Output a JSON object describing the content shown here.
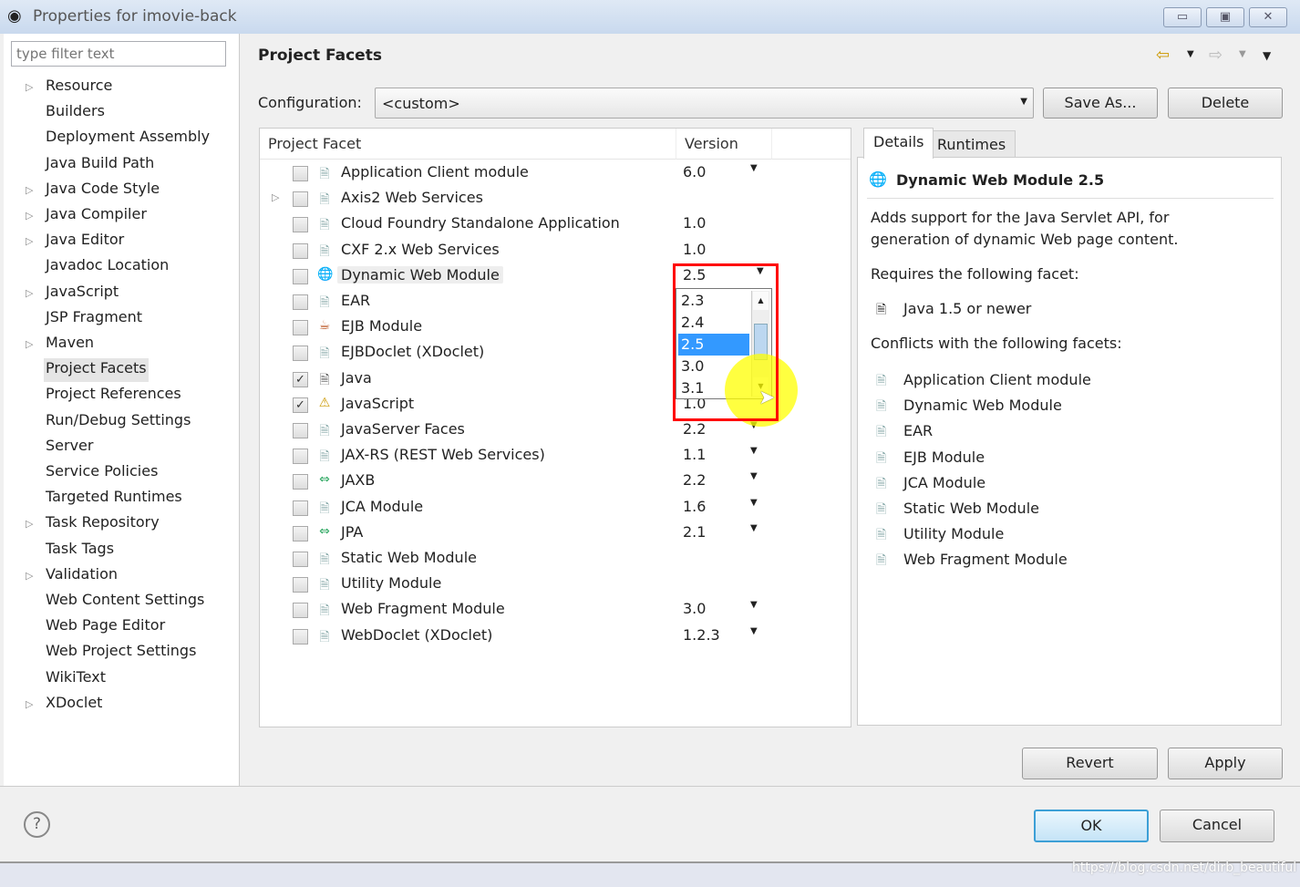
{
  "window": {
    "title": "Properties for imovie-back",
    "buttons": [
      "minimize",
      "maximize",
      "close"
    ]
  },
  "sidebar": {
    "filter_placeholder": "type filter text",
    "items": [
      {
        "label": "Resource",
        "expandable": true
      },
      {
        "label": "Builders"
      },
      {
        "label": "Deployment Assembly"
      },
      {
        "label": "Java Build Path"
      },
      {
        "label": "Java Code Style",
        "expandable": true
      },
      {
        "label": "Java Compiler",
        "expandable": true
      },
      {
        "label": "Java Editor",
        "expandable": true
      },
      {
        "label": "Javadoc Location"
      },
      {
        "label": "JavaScript",
        "expandable": true
      },
      {
        "label": "JSP Fragment"
      },
      {
        "label": "Maven",
        "expandable": true
      },
      {
        "label": "Project Facets",
        "selected": true
      },
      {
        "label": "Project References"
      },
      {
        "label": "Run/Debug Settings"
      },
      {
        "label": "Server"
      },
      {
        "label": "Service Policies"
      },
      {
        "label": "Targeted Runtimes"
      },
      {
        "label": "Task Repository",
        "expandable": true
      },
      {
        "label": "Task Tags"
      },
      {
        "label": "Validation",
        "expandable": true
      },
      {
        "label": "Web Content Settings"
      },
      {
        "label": "Web Page Editor"
      },
      {
        "label": "Web Project Settings"
      },
      {
        "label": "WikiText"
      },
      {
        "label": "XDoclet",
        "expandable": true
      }
    ]
  },
  "page": {
    "title": "Project Facets",
    "config_label": "Configuration:",
    "config_value": "<custom>",
    "save_as": "Save As...",
    "delete": "Delete",
    "col_facet": "Project Facet",
    "col_version": "Version"
  },
  "facets": [
    {
      "name": "Application Client module",
      "version": "6.0",
      "dropdown": true,
      "icon": "file"
    },
    {
      "name": "Axis2 Web Services",
      "version": "",
      "icon": "file",
      "expandable": true
    },
    {
      "name": "Cloud Foundry Standalone Application",
      "version": "1.0",
      "icon": "file"
    },
    {
      "name": "CXF 2.x Web Services",
      "version": "1.0",
      "icon": "file"
    },
    {
      "name": "Dynamic Web Module",
      "version": "2.5",
      "dropdown": true,
      "icon": "globe",
      "highlighted": true
    },
    {
      "name": "EAR",
      "version": "",
      "icon": "file"
    },
    {
      "name": "EJB Module",
      "version": "",
      "icon": "bean"
    },
    {
      "name": "EJBDoclet (XDoclet)",
      "version": "",
      "icon": "file"
    },
    {
      "name": "Java",
      "version": "",
      "icon": "java",
      "checked": true
    },
    {
      "name": "JavaScript",
      "version": "1.0",
      "icon": "js",
      "checked": true
    },
    {
      "name": "JavaServer Faces",
      "version": "2.2",
      "dropdown": true,
      "icon": "file"
    },
    {
      "name": "JAX-RS (REST Web Services)",
      "version": "1.1",
      "dropdown": true,
      "icon": "file"
    },
    {
      "name": "JAXB",
      "version": "2.2",
      "dropdown": true,
      "icon": "arrows"
    },
    {
      "name": "JCA Module",
      "version": "1.6",
      "dropdown": true,
      "icon": "file"
    },
    {
      "name": "JPA",
      "version": "2.1",
      "dropdown": true,
      "icon": "arrows"
    },
    {
      "name": "Static Web Module",
      "version": "",
      "icon": "file"
    },
    {
      "name": "Utility Module",
      "version": "",
      "icon": "file"
    },
    {
      "name": "Web Fragment Module",
      "version": "3.0",
      "dropdown": true,
      "icon": "file"
    },
    {
      "name": "WebDoclet (XDoclet)",
      "version": "1.2.3",
      "dropdown": true,
      "icon": "file"
    }
  ],
  "version_popup": {
    "options": [
      "2.3",
      "2.4",
      "2.5",
      "3.0",
      "3.1"
    ],
    "selected": "2.5"
  },
  "details": {
    "tabs": [
      "Details",
      "Runtimes"
    ],
    "active_tab": "Details",
    "title": "Dynamic Web Module 2.5",
    "desc1": "Adds support for the Java Servlet API, for",
    "desc2": "generation of dynamic Web page content.",
    "requires_label": "Requires the following facet:",
    "requires": [
      "Java 1.5 or newer"
    ],
    "conflicts_label": "Conflicts with the following facets:",
    "conflicts": [
      "Application Client module",
      "Dynamic Web Module",
      "EAR",
      "EJB Module",
      "JCA Module",
      "Static Web Module",
      "Utility Module",
      "Web Fragment Module"
    ]
  },
  "buttons": {
    "revert": "Revert",
    "apply": "Apply",
    "ok": "OK",
    "cancel": "Cancel",
    "help": "?"
  },
  "watermark": "https://blog.csdn.net/dirb_beautiful",
  "colors": {
    "selection": "#3399ff",
    "highlight_box": "#ff0000",
    "cursor_highlight": "#ffff00"
  }
}
